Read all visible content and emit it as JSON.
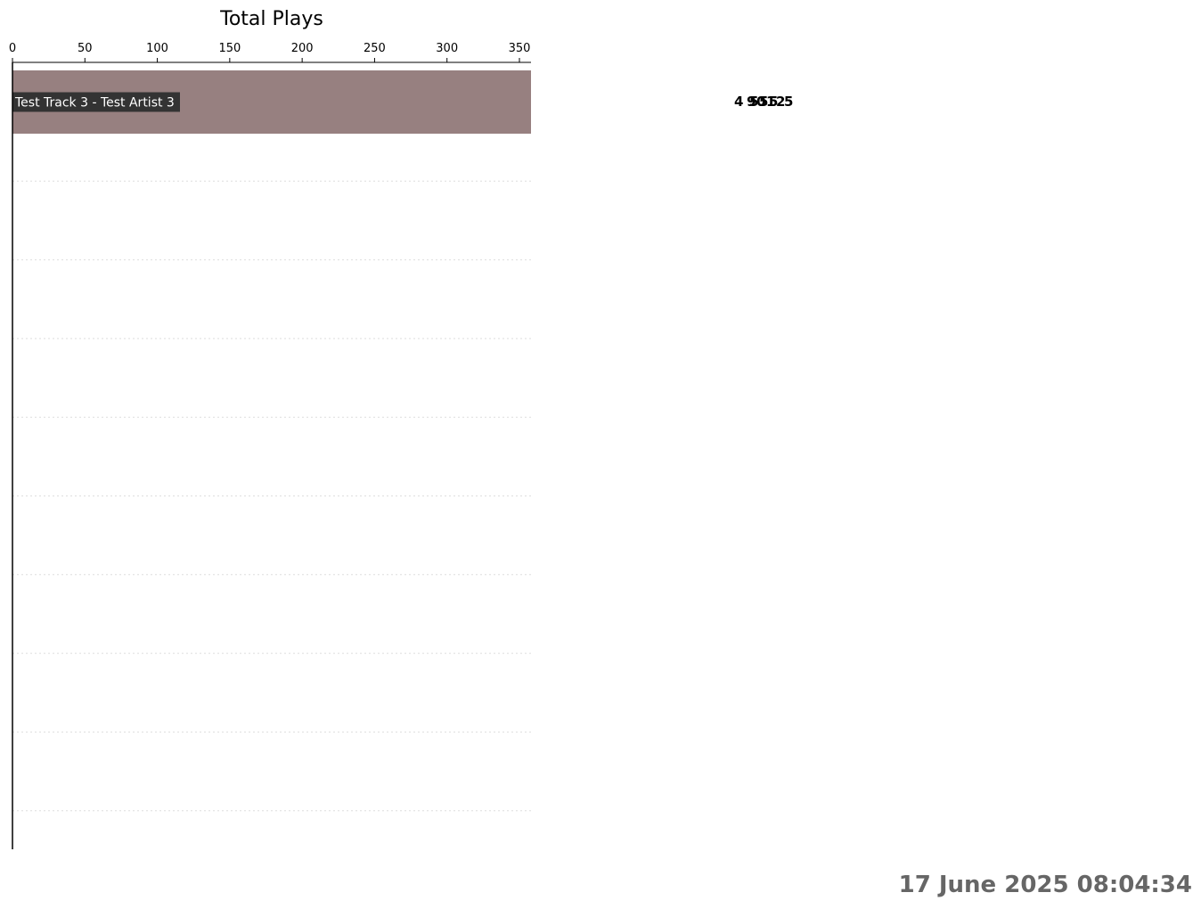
{
  "timestamp": "17 June 2025 08:04:34",
  "colors": {
    "bar": "#978080",
    "label_background": "#333333",
    "label_text": "#ffffff",
    "timestamp": "#666666",
    "grid": "#dddddd"
  },
  "chart_data": {
    "type": "bar",
    "orientation": "horizontal",
    "title": "Total Plays",
    "x_axis_position": "top",
    "xlim": [
      0,
      358
    ],
    "xticks": [
      0,
      50,
      100,
      150,
      200,
      250,
      300,
      350
    ],
    "categories": [
      "Test Track 3 - Test Artist 3"
    ],
    "values": [
      358
    ],
    "visible_slots": 10,
    "grid": "horizontal dotted",
    "overlapping_value_labels": [
      "4",
      "9",
      "5",
      "0",
      "5",
      "1",
      "5",
      "2",
      "5"
    ],
    "value_label_text": "4950515 25"
  }
}
